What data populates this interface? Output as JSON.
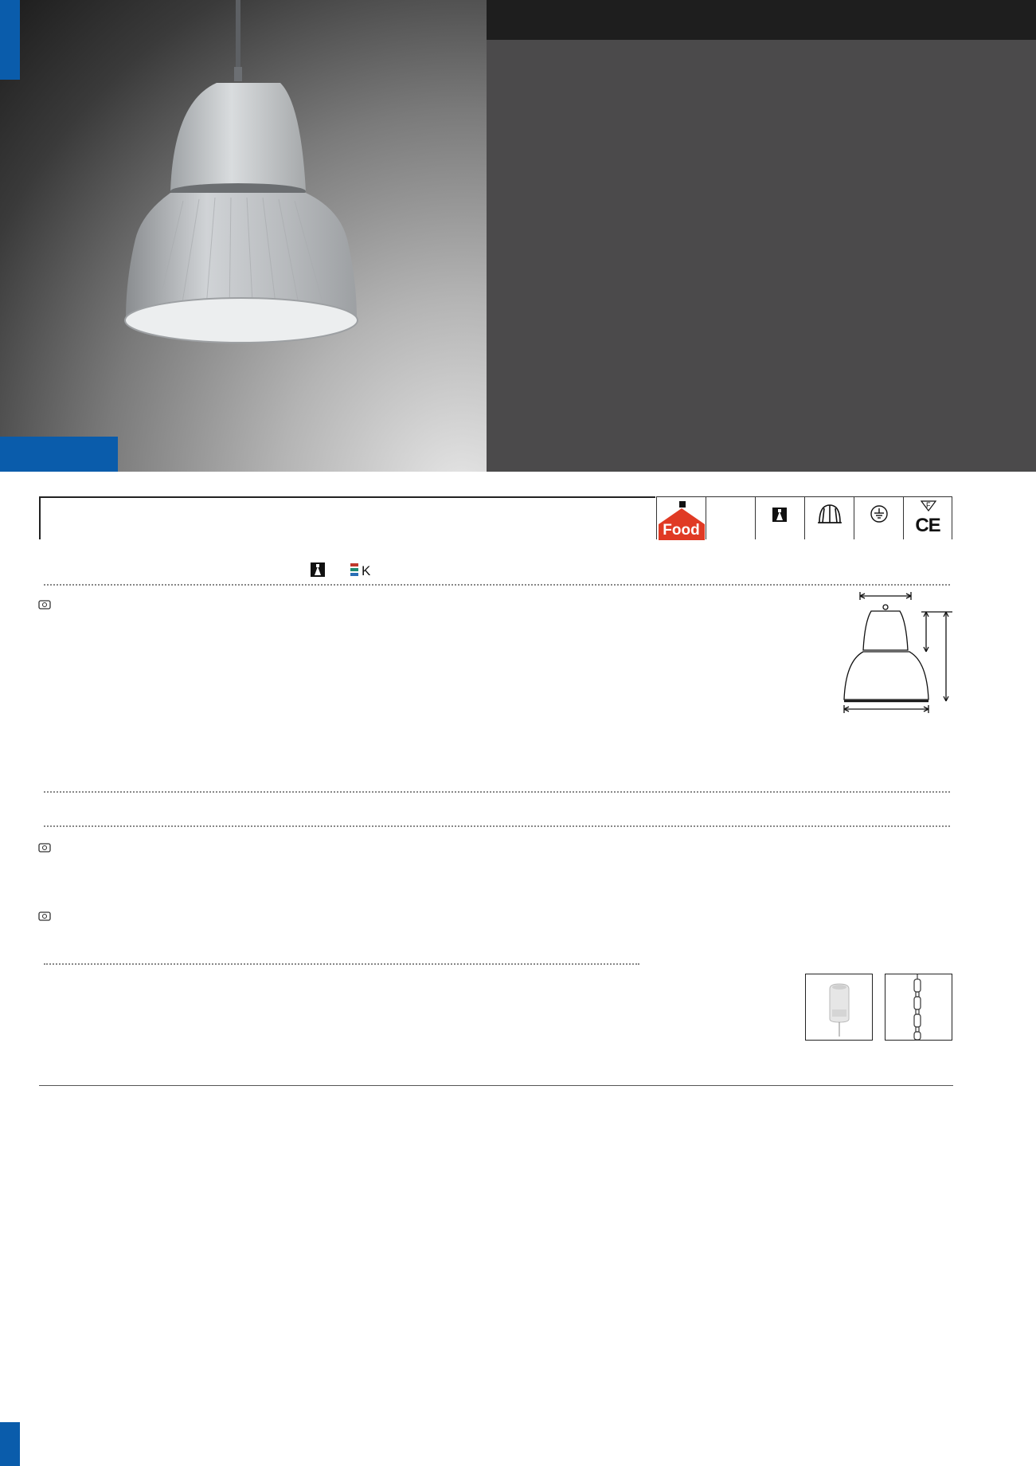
{
  "hero": {
    "photo_icon": "pendant-high-bay-luminaire"
  },
  "badges": [
    {
      "name": "food-badge",
      "label": "Food",
      "color": "#e03a24"
    },
    {
      "name": "blank-badge",
      "label": ""
    },
    {
      "name": "light-distribution-icon",
      "label": ""
    },
    {
      "name": "cage-guard-icon",
      "label": ""
    },
    {
      "name": "earth-ground-icon",
      "label": ""
    },
    {
      "name": "f-ce-mark-icon",
      "label": "CE"
    }
  ],
  "colors": {
    "accent_blue": "#0a5cab",
    "hero_dark": "#4b4a4b",
    "food_red": "#e03a24"
  }
}
